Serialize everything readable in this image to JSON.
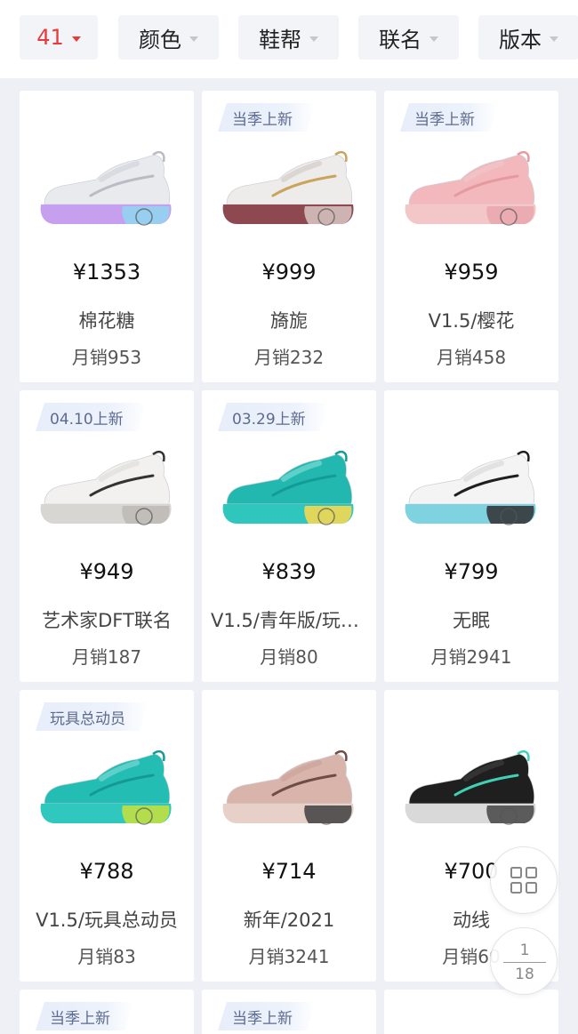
{
  "filters": [
    {
      "label": "41",
      "active": true
    },
    {
      "label": "颜色",
      "active": false
    },
    {
      "label": "鞋帮",
      "active": false
    },
    {
      "label": "联名",
      "active": false
    },
    {
      "label": "版本",
      "active": false
    }
  ],
  "products": [
    {
      "tag": "",
      "price": "¥1353",
      "name": "棉花糖",
      "sales": "月销953",
      "colors": {
        "upper": "#e9eaee",
        "accent": "#b9bcc4",
        "sole": "#c6a0ee",
        "sole2": "#8fd6ee",
        "lace": "#d9dbe0"
      }
    },
    {
      "tag": "当季上新",
      "price": "¥999",
      "name": "旖旎",
      "sales": "月销232",
      "colors": {
        "upper": "#eeeceb",
        "accent": "#c9a45a",
        "sole": "#8d4850",
        "sole2": "#d8c8c4",
        "lace": "#dcd6d2"
      }
    },
    {
      "tag": "当季上新",
      "price": "¥959",
      "name": "V1.5/樱花",
      "sales": "月销458",
      "colors": {
        "upper": "#f2b8bb",
        "accent": "#e59aa0",
        "sole": "#f3c6c8",
        "sole2": "#e7a7ad",
        "lace": "#f0c2c6"
      }
    },
    {
      "tag": "04.10上新",
      "price": "¥949",
      "name": "艺术家DFT联名",
      "sales": "月销187",
      "colors": {
        "upper": "#f2f1ef",
        "accent": "#333333",
        "sole": "#d8d6d2",
        "sole2": "#bdb9b4",
        "lace": "#e6e4e1"
      }
    },
    {
      "tag": "03.29上新",
      "price": "¥839",
      "name": "V1.5/青年版/玩具总动员",
      "sales": "月销80",
      "colors": {
        "upper": "#22b8b0",
        "accent": "#139c96",
        "sole": "#2ec6bd",
        "sole2": "#ffd84a",
        "lace": "#5fd0c9"
      }
    },
    {
      "tag": "",
      "price": "¥799",
      "name": "无眠",
      "sales": "月销2941",
      "colors": {
        "upper": "#f4f4f4",
        "accent": "#1f1f1f",
        "sole": "#7fd2e0",
        "sole2": "#2f2f2f",
        "lace": "#e2e2e2"
      }
    },
    {
      "tag": "玩具总动员",
      "price": "¥788",
      "name": "V1.5/玩具总动员",
      "sales": "月销83",
      "colors": {
        "upper": "#23bdb4",
        "accent": "#149a93",
        "sole": "#2fc7be",
        "sole2": "#c9e23a",
        "lace": "#5fd0c9"
      }
    },
    {
      "tag": "",
      "price": "¥714",
      "name": "新年/2021",
      "sales": "月销3241",
      "colors": {
        "upper": "#d8b4aa",
        "accent": "#6d4d46",
        "sole": "#e6d0c8",
        "sole2": "#3f3f3f",
        "lace": "#cfa9a0"
      }
    },
    {
      "tag": "",
      "price": "¥700",
      "name": "动线",
      "sales": "月销60",
      "colors": {
        "upper": "#1f1f1f",
        "accent": "#3fd0b7",
        "sole": "#d9d9d9",
        "sole2": "#444444",
        "lace": "#333333"
      }
    },
    {
      "tag": "当季上新",
      "price": "",
      "name": "",
      "sales": "",
      "colors": {}
    },
    {
      "tag": "当季上新",
      "price": "",
      "name": "",
      "sales": "",
      "colors": {}
    },
    {
      "tag": "",
      "price": "",
      "name": "",
      "sales": "",
      "colors": {}
    }
  ],
  "pagination": {
    "current": "1",
    "total": "18"
  },
  "icons": {
    "grid_toggle": "grid-view-icon",
    "caret": "caret-down-icon"
  },
  "colors": {
    "accent": "#e83a3a",
    "background": "#eef0f6",
    "tag_text": "#5d6b8e"
  }
}
